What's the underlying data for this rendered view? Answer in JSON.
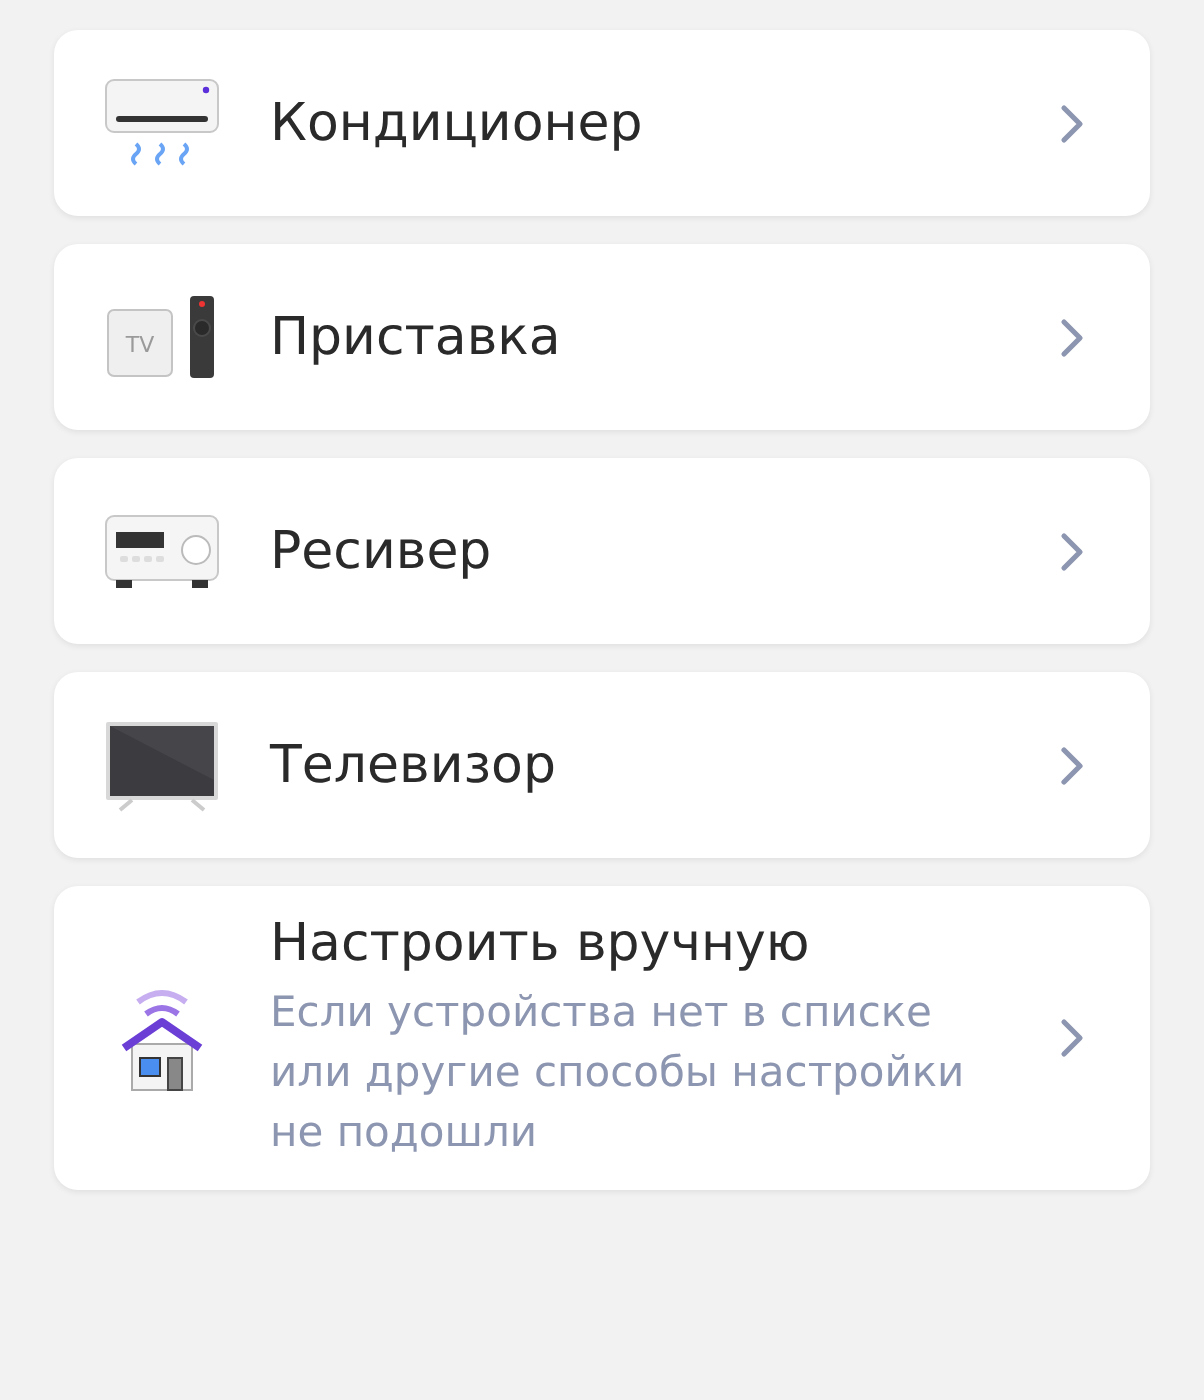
{
  "items": [
    {
      "kind": "ac",
      "title": "Кондиционер"
    },
    {
      "kind": "tvbox",
      "title": "Приставка",
      "icon_label": "TV"
    },
    {
      "kind": "receiver",
      "title": "Ресивер"
    },
    {
      "kind": "tv",
      "title": "Телевизор"
    },
    {
      "kind": "manual",
      "title": "Настроить вручную",
      "subtitle": "Если устройства нет в списке или другие способы настройки не подошли"
    }
  ]
}
